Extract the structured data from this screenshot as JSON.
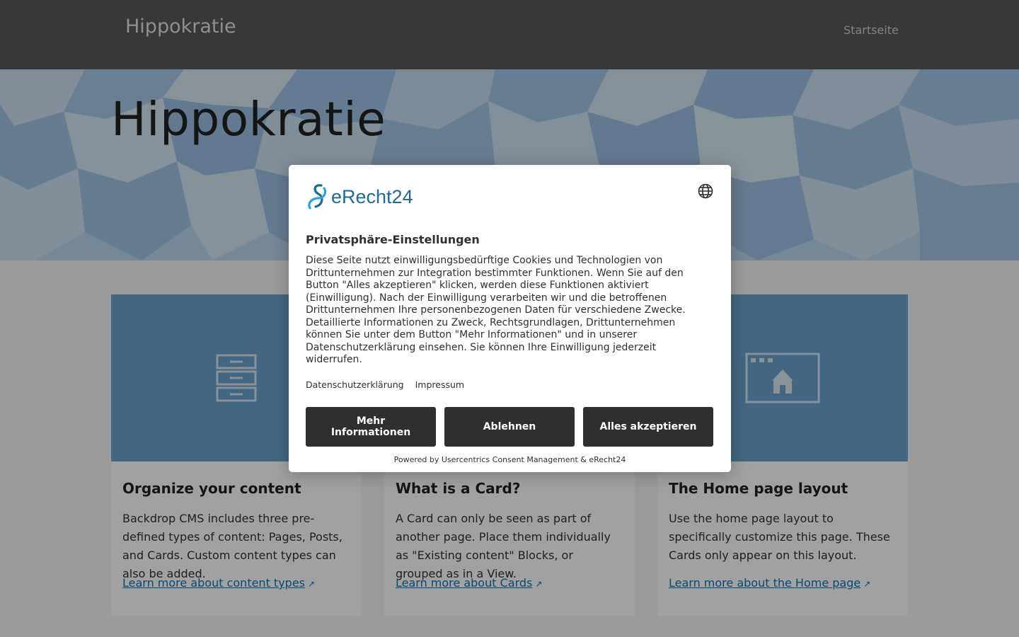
{
  "header": {
    "site_name": "Hippokratie",
    "nav": {
      "home": "Startseite"
    }
  },
  "hero": {
    "title": "Hippokratie"
  },
  "cards": [
    {
      "title": "Organize your content",
      "text": "Backdrop CMS includes three pre-defined types of content: Pages, Posts, and Cards. Custom content types can also be added.",
      "link": "Learn more about content types",
      "icon": "file-cabinet-icon"
    },
    {
      "title": "What is a Card?",
      "text": "A Card can only be seen as part of another page. Place them individually as \"Existing content\" Blocks, or grouped as in a View.",
      "link": "Learn more about Cards",
      "icon": "card-icon"
    },
    {
      "title": "The Home page layout",
      "text": "Use the home page layout to specifically customize this page. These Cards only appear on this layout.",
      "link": "Learn more about the Home page",
      "icon": "home-window-icon"
    }
  ],
  "consent": {
    "logo_text": "eRecht24",
    "title": "Privatsphäre-Einstellungen",
    "body": "Diese Seite nutzt einwilligungsbedürftige Cookies und Technologien von Drittunternehmen zur Integration bestimmter Funktionen. Wenn Sie auf den Button \"Alles akzeptieren\" klicken, werden diese Funktionen aktiviert (Einwilligung). Nach der Einwilligung verarbeiten wir und die betroffenen Drittunternehmen Ihre personenbezogenen Daten für verschiedene Zwecke. Detaillierte Informationen zu Zweck, Rechtsgrundlagen, Drittunternehmen können Sie unter dem Button \"Mehr Informationen\" und in unserer Datenschutzerklärung einsehen. Sie können Ihre Einwilligung jederzeit widerrufen.",
    "links": {
      "privacy": "Datenschutzerklärung",
      "imprint": "Impressum"
    },
    "buttons": {
      "more_info": "Mehr Informationen",
      "deny": "Ablehnen",
      "accept_all": "Alles akzeptieren"
    },
    "powered_by": "Powered by Usercentrics Consent Management & eRecht24"
  },
  "colors": {
    "header_bg": "#58595b",
    "card_media_bg": "#6ba3cf",
    "link": "#0f75b5",
    "button_bg": "#2e2f31",
    "logo_blue": "#1d6a96"
  }
}
